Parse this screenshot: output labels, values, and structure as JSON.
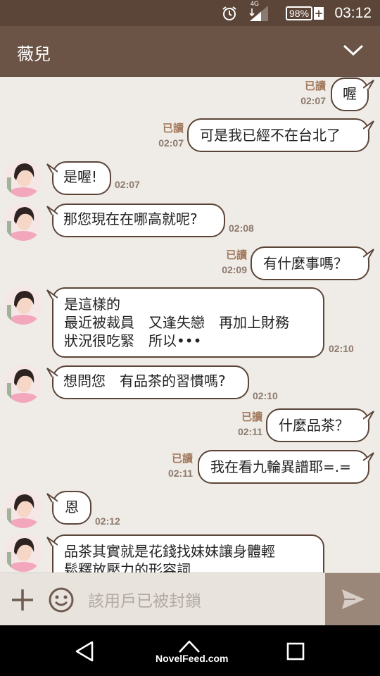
{
  "status_bar": {
    "network": "4G",
    "battery": "98%",
    "time": "03:12"
  },
  "header": {
    "title": "薇兒"
  },
  "messages": [
    {
      "side": "right",
      "text": "喔",
      "read": "已讀",
      "time": "02:07"
    },
    {
      "side": "right",
      "text": "可是我已經不在台北了",
      "read": "已讀",
      "time": "02:07"
    },
    {
      "side": "left",
      "text": "是喔!",
      "time": "02:07"
    },
    {
      "side": "left",
      "text": "那您現在在哪高就呢?",
      "time": "02:08"
    },
    {
      "side": "right",
      "text": "有什麼事嗎？",
      "read": "已讀",
      "time": "02:09"
    },
    {
      "side": "left",
      "text": "是這樣的\n最近被裁員　又逢失戀　再加上財務\n狀況很吃緊　所以•••",
      "time": "02:10"
    },
    {
      "side": "left",
      "text": "想問您　有品茶的習慣嗎?",
      "time": "02:10"
    },
    {
      "side": "right",
      "text": "什麼品茶？",
      "read": "已讀",
      "time": "02:11"
    },
    {
      "side": "right",
      "text": "我在看九輪異譜耶=.=",
      "read": "已讀",
      "time": "02:11"
    },
    {
      "side": "left",
      "text": "恩",
      "time": "02:12"
    },
    {
      "side": "left",
      "text": "品茶其實就是花錢找妹妹讓身體輕\n鬆釋放壓力的形容詞",
      "time": ""
    }
  ],
  "input": {
    "placeholder": "該用戶已被封鎖"
  },
  "watermark": "NovelFeed.com",
  "colors": {
    "status_bar": "#5b4539",
    "header": "#6b5446",
    "chat_bg": "#efebe6",
    "bubble_border": "#5b4539",
    "send_button": "#9b8779"
  }
}
